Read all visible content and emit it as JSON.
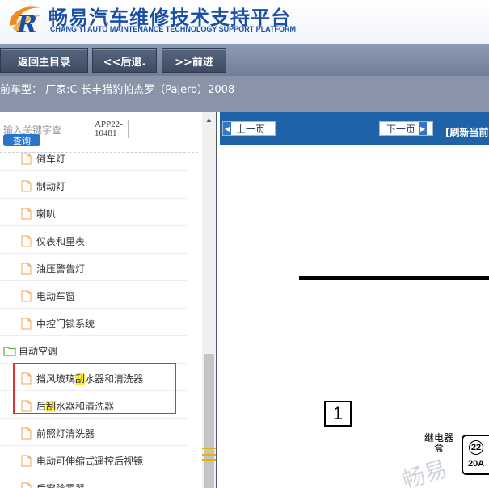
{
  "header": {
    "brand_cn": "畅易汽车维修技术支持平台",
    "brand_en": "CHANG YI AUTO MAINTENANCE TECHNOLOGY SUPPORT PLATFORM",
    "logo_letter": "R",
    "colors": {
      "brand_blue": "#1a4fa3",
      "logo_orange": "#f08a1c"
    }
  },
  "nav": {
    "home_label": "返回主目录",
    "back_label": "<<后退.",
    "forward_label": ">>前进"
  },
  "vehicle": {
    "text": "前车型： 厂家:C-长丰猎豹帕杰罗（Pajero）2008"
  },
  "left": {
    "search_placeholder": "输入关键字查",
    "query_label": "查询",
    "doc_code": "APP22-10481",
    "tree": [
      {
        "label": "倒车灯",
        "kind": "file"
      },
      {
        "label": "制动灯",
        "kind": "file"
      },
      {
        "label": "喇叭",
        "kind": "file"
      },
      {
        "label": "仪表和里表",
        "kind": "file"
      },
      {
        "label": "油压警告灯",
        "kind": "file"
      },
      {
        "label": "电动车窗",
        "kind": "file"
      },
      {
        "label": "中控门锁系统",
        "kind": "file"
      },
      {
        "label": "自动空调",
        "kind": "folder"
      },
      {
        "label_pre": "挡风玻璃",
        "label_hl": "刮",
        "label_post": "水器和清洗器",
        "kind": "file"
      },
      {
        "label_pre": "后",
        "label_hl": "刮",
        "label_post": "水器和清洗器",
        "kind": "file"
      },
      {
        "label": "前照灯清洗器",
        "kind": "file"
      },
      {
        "label": "电动可伸缩式遥控后视镜",
        "kind": "file"
      },
      {
        "label": "后窗除雾器",
        "kind": "file"
      }
    ],
    "highlight_color": "#ffeb3b",
    "selection_box_color": "#e0322f"
  },
  "right": {
    "prev_label": "上一页",
    "next_label": "下一页",
    "refresh_label": "[刷新当前",
    "diagram": {
      "box_number": "1",
      "relay_label": "继电器盒",
      "fuse_number": "22",
      "fuse_rating": "20A"
    },
    "watermark": "畅易"
  }
}
